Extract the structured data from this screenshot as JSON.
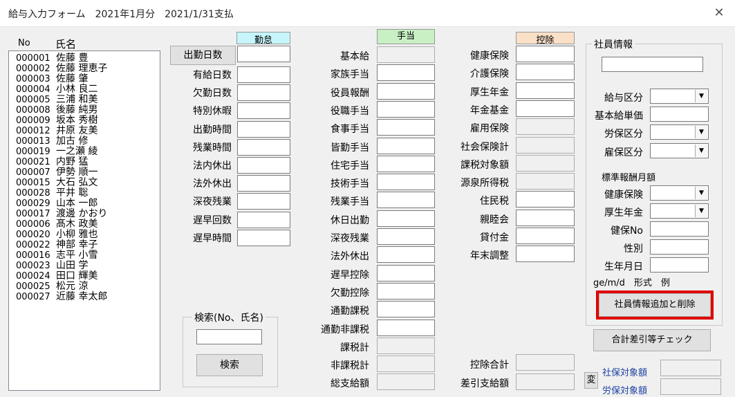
{
  "window": {
    "title": "給与入力フォーム　2021年1月分　2021/1/31支払",
    "close_glyph": "✕"
  },
  "list": {
    "col_no": "No",
    "col_name": "氏名",
    "employees": [
      {
        "no": "000001",
        "name": "佐藤 豊"
      },
      {
        "no": "000002",
        "name": "佐藤 理恵子"
      },
      {
        "no": "000003",
        "name": "佐藤 肇"
      },
      {
        "no": "000004",
        "name": "小林 良二"
      },
      {
        "no": "000005",
        "name": "三浦 和美"
      },
      {
        "no": "000008",
        "name": "後藤 純男"
      },
      {
        "no": "000009",
        "name": "坂本 秀樹"
      },
      {
        "no": "000012",
        "name": "井原 友美"
      },
      {
        "no": "000013",
        "name": "加古 修"
      },
      {
        "no": "000019",
        "name": "一之瀬 綾"
      },
      {
        "no": "000021",
        "name": "内野 猛"
      },
      {
        "no": "000007",
        "name": "伊勢 順一"
      },
      {
        "no": "000015",
        "name": "大石 弘文"
      },
      {
        "no": "000028",
        "name": "平井 聡"
      },
      {
        "no": "000029",
        "name": "山本 一郎"
      },
      {
        "no": "000017",
        "name": "渡邊 かおり"
      },
      {
        "no": "000006",
        "name": "髙木 政美"
      },
      {
        "no": "000020",
        "name": "小柳 雅也"
      },
      {
        "no": "000022",
        "name": "神部 幸子"
      },
      {
        "no": "000016",
        "name": "志平 小雪"
      },
      {
        "no": "000023",
        "name": "山田 学"
      },
      {
        "no": "000024",
        "name": "田口 輝美"
      },
      {
        "no": "000025",
        "name": "松元 涼"
      },
      {
        "no": "000027",
        "name": "近藤 幸太郎"
      }
    ]
  },
  "kintai": {
    "header": "勤怠",
    "button": "出勤日数",
    "labels": [
      "有給日数",
      "欠勤日数",
      "特別休暇",
      "出勤時間",
      "残業時間",
      "法内休出",
      "法外休出",
      "深夜残業",
      "遅早回数",
      "遅早時間"
    ]
  },
  "search": {
    "group_label": "検索(No、氏名)",
    "input_value": "",
    "button": "検索"
  },
  "teate": {
    "header": "手当",
    "labels": [
      "基本給",
      "家族手当",
      "役員報酬",
      "役職手当",
      "食事手当",
      "皆勤手当",
      "住宅手当",
      "技術手当",
      "残業手当",
      "休日出勤",
      "深夜残業",
      "法外休出",
      "遅早控除",
      "欠勤控除",
      "通勤課税",
      "通勤非課税",
      "課税計",
      "非課税計",
      "総支給額"
    ]
  },
  "koujo": {
    "header": "控除",
    "labels": [
      "健康保険",
      "介護保険",
      "厚生年金",
      "年金基金",
      "雇用保険",
      "社会保険計",
      "課税対象額",
      "源泉所得税",
      "住民税",
      "親睦会",
      "貸付金",
      "年末調整"
    ],
    "total_label": "控除合計",
    "net_label": "差引支給額"
  },
  "shain": {
    "group_label": "社員情報",
    "name_value": "",
    "fields": [
      "給与区分",
      "基本給単価",
      "労保区分",
      "雇保区分"
    ],
    "std_label": "標準報酬月額",
    "std_fields": [
      "健康保険",
      "厚生年金"
    ],
    "other_fields": [
      "健保No",
      "性別",
      "生年月日"
    ],
    "date_hint": "ge/m/d　形式　例",
    "manage_button": "社員情報追加と削除"
  },
  "check_button": "合計差引等チェック",
  "hen_button": "変",
  "shaho_label": "社保対象額",
  "rouho_label": "労保対象額",
  "colors": {
    "kintai_header": "#c6f6fb",
    "teate_header": "#c8f0c4",
    "koujo_header": "#fbe0c8",
    "highlight": "#e00000",
    "blue_text": "#1a3fa0"
  }
}
